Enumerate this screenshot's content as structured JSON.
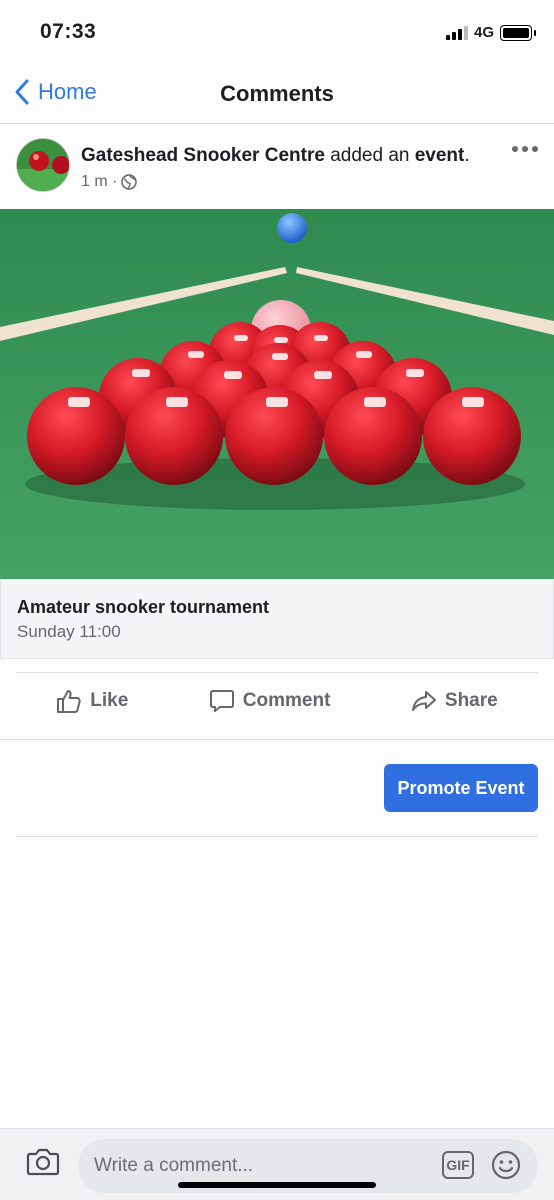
{
  "status_bar": {
    "time": "07:33",
    "network": "4G"
  },
  "nav": {
    "back_label": "Home",
    "title": "Comments"
  },
  "post": {
    "author": "Gateshead Snooker Centre",
    "action_text": " added an ",
    "object": "event",
    "punctuation": ".",
    "time": "1 m ·"
  },
  "event": {
    "name": "Amateur snooker tournament",
    "time": "Sunday 11:00"
  },
  "actions": {
    "like": "Like",
    "comment": "Comment",
    "share": "Share"
  },
  "promote": {
    "label": "Promote Event"
  },
  "comment_bar": {
    "placeholder": "Write a comment...",
    "gif_label": "GIF"
  },
  "colors": {
    "accent": "#2f6fe0",
    "link": "#2f7ae5",
    "table_green": "#3f9b5d",
    "ball_red": "#d01d28"
  }
}
